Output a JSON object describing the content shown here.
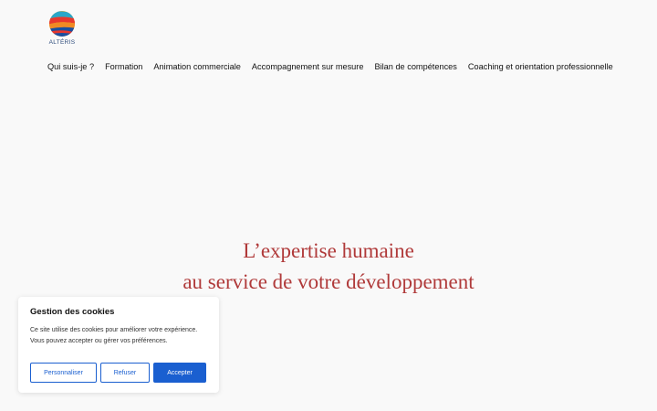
{
  "brand": {
    "name": "ALTÉRIS",
    "tagline": "",
    "colors": {
      "red": "#e8382e",
      "orange": "#f5a623",
      "blue": "#1a4fa0",
      "teal": "#2aa7c9"
    }
  },
  "nav": {
    "items": [
      "Qui suis-je ?",
      "Formation",
      "Animation commerciale",
      "Accompagnement sur mesure",
      "Bilan de compétences",
      "Coaching et orientation professionnelle"
    ]
  },
  "hero": {
    "line1": "L’expertise humaine",
    "line2": "au service de votre développement",
    "color": "#b03a3a"
  },
  "cookie": {
    "title": "Gestion des cookies",
    "text": "Ce site utilise des cookies pour améliorer votre expérience. Vous pouvez accepter ou gérer vos préférences.",
    "customize_label": "Personnaliser",
    "refuse_label": "Refuser",
    "accept_label": "Accepter",
    "accent_color": "#1a5fd0"
  }
}
